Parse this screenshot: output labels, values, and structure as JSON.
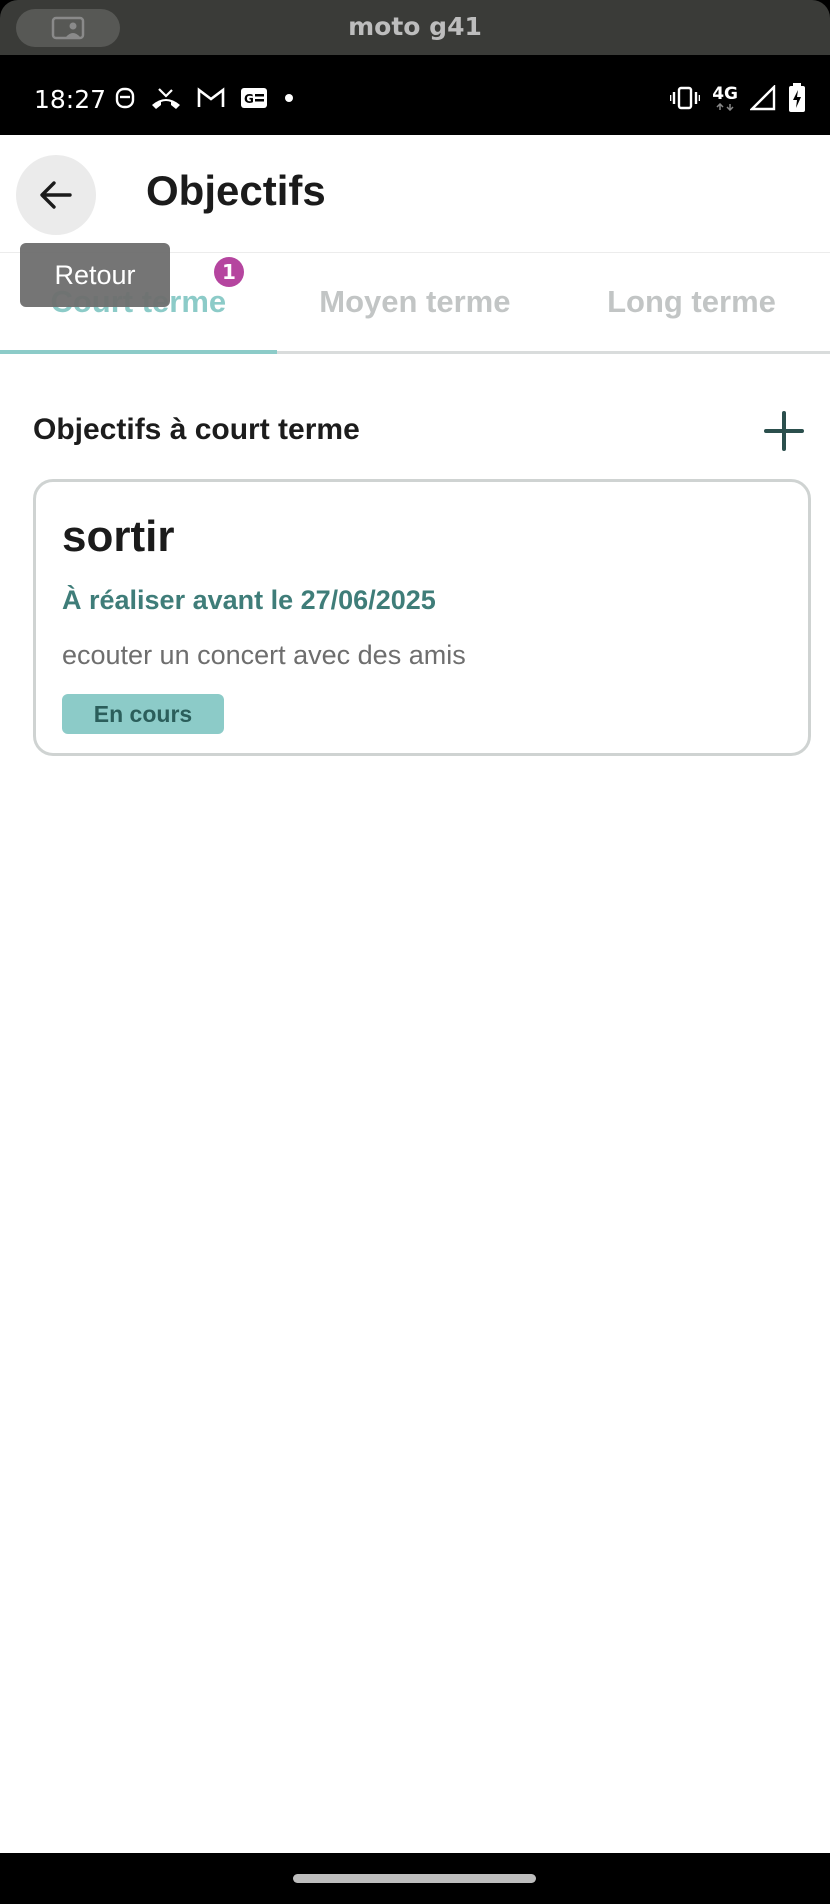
{
  "window": {
    "title": "moto g41"
  },
  "status_bar": {
    "time": "18:27",
    "network": "4G",
    "left_icons": [
      "robot-icon",
      "missed-call-icon",
      "gmail-icon",
      "news-icon",
      "dot-icon"
    ],
    "right_icons": [
      "vibrate-icon",
      "signal-icon",
      "battery-charging-icon"
    ]
  },
  "header": {
    "title": "Objectifs",
    "back_tooltip": "Retour"
  },
  "tabs": [
    {
      "label": "Court terme",
      "active": true,
      "badge": "1"
    },
    {
      "label": "Moyen terme",
      "active": false
    },
    {
      "label": "Long terme",
      "active": false
    }
  ],
  "section": {
    "title": "Objectifs à court terme"
  },
  "goals": [
    {
      "title": "sortir",
      "deadline": "À réaliser avant le 27/06/2025",
      "description": "ecouter un concert avec des amis",
      "status": "En cours"
    }
  ],
  "colors": {
    "accent": "#8ccbc8",
    "accent_dark": "#3f7d79",
    "badge": "#b5459f"
  }
}
